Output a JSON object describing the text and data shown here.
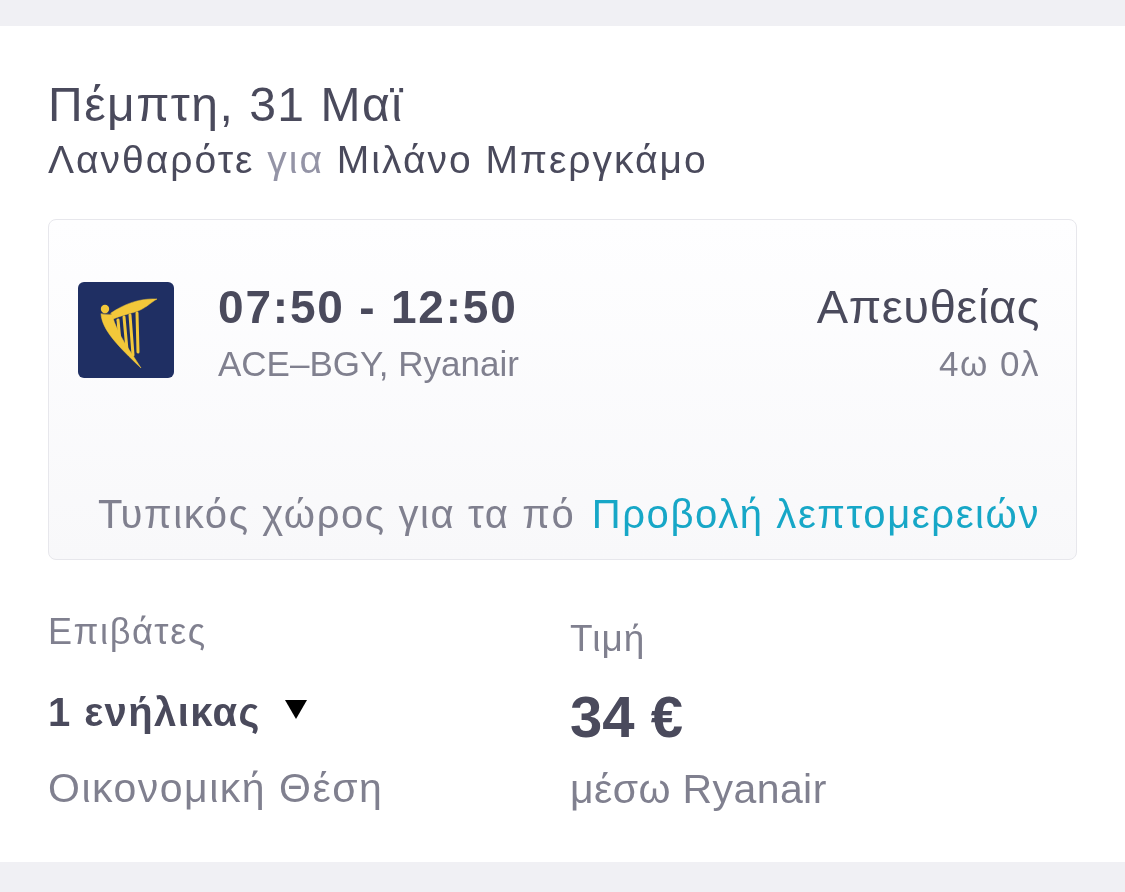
{
  "header": {
    "date": "Πέμπτη, 31 Μαϊ",
    "route": {
      "origin": "Λανθαρότε",
      "connector": "για",
      "destination": "Μιλάνο Μπεργκάμο"
    }
  },
  "flight": {
    "times": "07:50 - 12:50",
    "route_airline": "ACE–BGY, Ryanair",
    "stops": "Απευθείας",
    "duration": "4ω 0λ",
    "baggage_note": "Τυπικός χώρος για τα πό",
    "details_link": "Προβολή λεπτομερειών"
  },
  "passengers": {
    "label": "Επιβάτες",
    "value": "1 ενήλικας",
    "cabin_class": "Οικονομική Θέση"
  },
  "price": {
    "label": "Τιμή",
    "amount": "34 €",
    "via": "μέσω Ryanair"
  }
}
